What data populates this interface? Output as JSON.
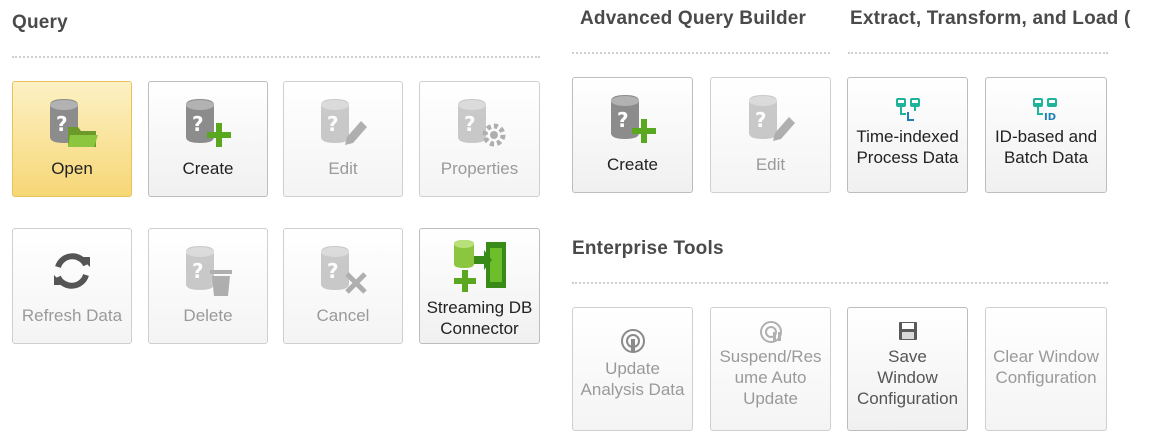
{
  "sections": {
    "query": "Query",
    "advanced": "Advanced Query Builder",
    "etl": "Extract, Transform, and Load (",
    "enterprise": "Enterprise Tools"
  },
  "query_buttons": {
    "open": "Open",
    "create": "Create",
    "edit": "Edit",
    "properties": "Properties",
    "refresh": "Refresh Data",
    "delete": "Delete",
    "cancel": "Cancel",
    "streaming": "Streaming DB\nConnector"
  },
  "advanced_buttons": {
    "create": "Create",
    "edit": "Edit"
  },
  "etl_buttons": {
    "time_indexed": "Time-indexed\nProcess Data",
    "id_based": "ID-based and\nBatch Data"
  },
  "enterprise_buttons": {
    "update": "Update\nAnalysis Data",
    "suspend": "Suspend/Res\nume Auto\nUpdate",
    "save": "Save\nWindow\nConfiguration",
    "clear": "Clear Window\nConfiguration"
  },
  "icons": {
    "open": "database-folder-icon",
    "create": "database-plus-icon",
    "edit": "database-pencil-icon",
    "properties": "database-gear-icon",
    "refresh": "refresh-icon",
    "delete": "database-trash-icon",
    "cancel": "database-x-icon",
    "streaming": "streaming-connector-icon",
    "time_indexed": "time-indexed-icon",
    "id_based": "id-based-icon",
    "update": "broadcast-icon",
    "suspend": "broadcast-pause-icon",
    "save": "floppy-icon"
  },
  "colors": {
    "selected": "#f6d777",
    "accent_green": "#5aa81f",
    "accent_teal": "#1fb39a"
  }
}
